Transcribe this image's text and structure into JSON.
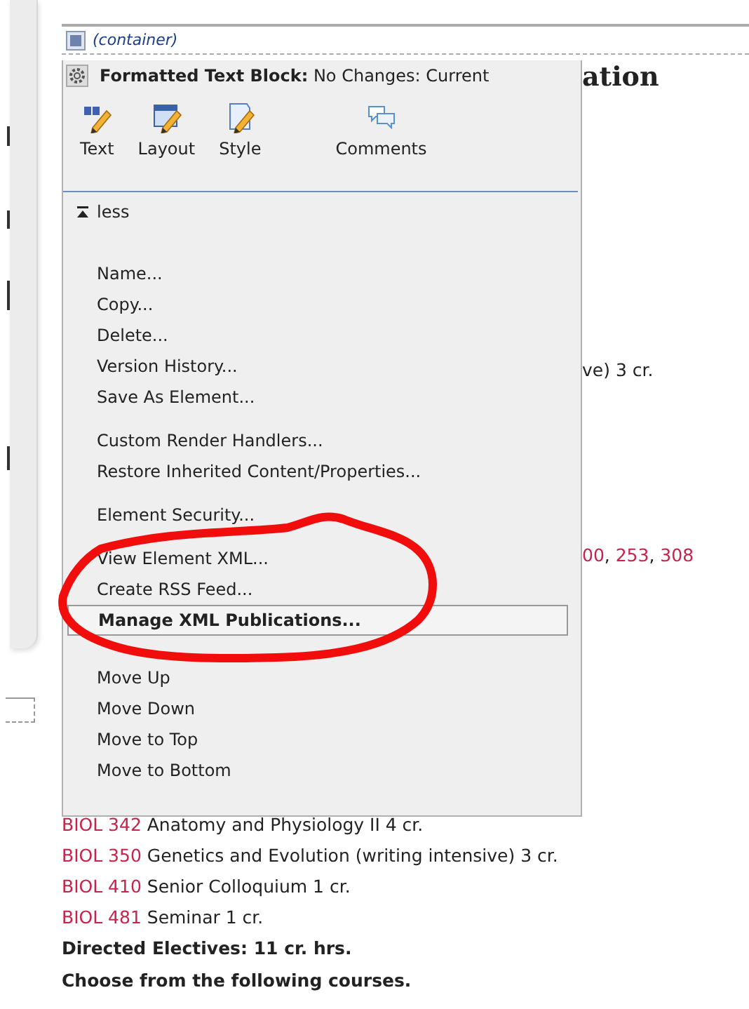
{
  "container_bar": {
    "label": "(container)"
  },
  "menu": {
    "header": "**Formatted Text Block:** No Changes: Current",
    "toolbar": [
      {
        "kind": "text",
        "label": "Text"
      },
      {
        "kind": "layout",
        "label": "Layout"
      },
      {
        "kind": "style",
        "label": "Style"
      },
      {
        "kind": "comments",
        "label": "Comments"
      }
    ],
    "toggle": {
      "label": "less",
      "expanded": true
    },
    "groups": [
      [
        {
          "label": "Name...",
          "selected": false
        },
        {
          "label": "Copy...",
          "selected": false
        },
        {
          "label": "Delete...",
          "selected": false
        },
        {
          "label": "Version History...",
          "selected": false
        },
        {
          "label": "Save As Element...",
          "selected": false
        }
      ],
      [
        {
          "label": "Custom Render Handlers...",
          "selected": false
        },
        {
          "label": "Restore Inherited Content/Properties...",
          "selected": false
        }
      ],
      [
        {
          "label": "Element Security...",
          "selected": false
        }
      ],
      [
        {
          "label": "View Element XML...",
          "selected": false
        },
        {
          "label": "Create RSS Feed...",
          "selected": false
        },
        {
          "label": "Manage XML Publications...",
          "selected": true
        }
      ],
      [
        {
          "label": "Move Up",
          "selected": false
        },
        {
          "label": "Move Down",
          "selected": false
        },
        {
          "label": "Move to Top",
          "selected": false
        },
        {
          "label": "Move to Bottom",
          "selected": false
        }
      ]
    ]
  },
  "page": {
    "heading_fragment": "ation",
    "fragments": [
      [
        {
          "text": "ve) 3 cr.",
          "link": false
        }
      ],
      [
        {
          "text": "00",
          "link": true
        },
        {
          "text": ", ",
          "link": false
        },
        {
          "text": "253",
          "link": true
        },
        {
          "text": ", ",
          "link": false
        },
        {
          "text": "308",
          "link": true
        }
      ]
    ],
    "courses": [
      {
        "code": "BIOL 342",
        "title": "Anatomy and Physiology II 4 cr."
      },
      {
        "code": "BIOL 350",
        "title": "Genetics and Evolution (writing intensive) 3 cr."
      },
      {
        "code": "BIOL 410",
        "title": "Senior Colloquium 1 cr."
      },
      {
        "code": "BIOL 481",
        "title": "Seminar 1 cr."
      }
    ],
    "headings": [
      "Directed Electives: 11 cr. hrs.",
      "Choose from the following courses."
    ]
  }
}
